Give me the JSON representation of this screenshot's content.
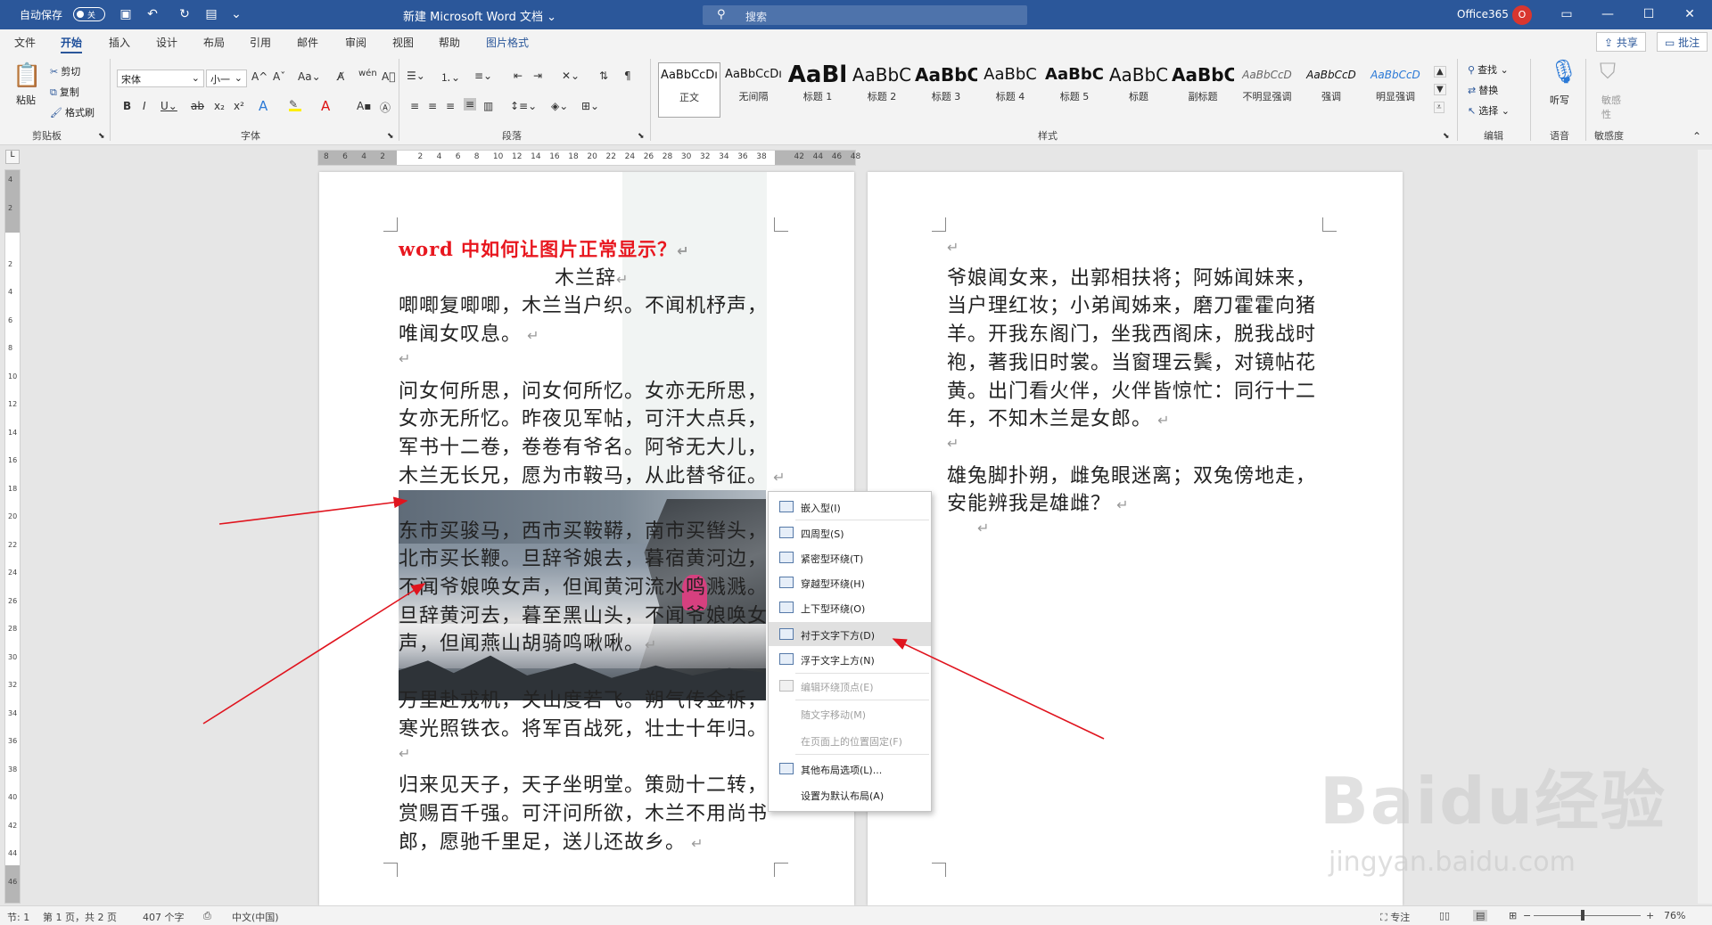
{
  "titlebar": {
    "autosave_label": "自动保存",
    "autosave_state": "关",
    "doc_title": "新建 Microsoft Word 文档",
    "search_placeholder": "搜索",
    "account": "Office365",
    "avatar_letter": "O"
  },
  "tabs": [
    "文件",
    "开始",
    "插入",
    "设计",
    "布局",
    "引用",
    "邮件",
    "审阅",
    "视图",
    "帮助",
    "图片格式"
  ],
  "active_tab": "开始",
  "share_label": "共享",
  "comment_label": "批注",
  "ribbon": {
    "clipboard": {
      "paste": "粘贴",
      "cut": "剪切",
      "copy": "复制",
      "format_painter": "格式刷",
      "group": "剪贴板"
    },
    "font": {
      "font_name": "宋体",
      "font_size": "小一",
      "group": "字体"
    },
    "paragraph": {
      "group": "段落"
    },
    "styles": {
      "group": "样式",
      "items": [
        {
          "sample": "AaBbCcDı",
          "name": "正文"
        },
        {
          "sample": "AaBbCcDı",
          "name": "无间隔"
        },
        {
          "sample": "AaBl",
          "name": "标题 1"
        },
        {
          "sample": "AaBbC",
          "name": "标题 2"
        },
        {
          "sample": "AaBbC",
          "name": "标题 3"
        },
        {
          "sample": "AaBbC",
          "name": "标题 4"
        },
        {
          "sample": "AaBbC",
          "name": "标题 5"
        },
        {
          "sample": "AaBbC",
          "name": "标题"
        },
        {
          "sample": "AaBbC",
          "name": "副标题"
        },
        {
          "sample": "AaBbCcD",
          "name": "不明显强调"
        },
        {
          "sample": "AaBbCcD",
          "name": "强调"
        },
        {
          "sample": "AaBbCcD",
          "name": "明显强调"
        }
      ]
    },
    "editing": {
      "find": "查找",
      "replace": "替换",
      "select": "选择",
      "group": "编辑"
    },
    "voice": {
      "dictate": "听写",
      "group": "语音"
    },
    "sensitivity": {
      "label": "敏感性",
      "group": "敏感度"
    }
  },
  "ruler_h_labels": [
    "8",
    "6",
    "4",
    "2",
    "",
    "2",
    "4",
    "6",
    "8",
    "10",
    "12",
    "14",
    "16",
    "18",
    "20",
    "22",
    "24",
    "26",
    "28",
    "30",
    "32",
    "34",
    "36",
    "38",
    "",
    "42",
    "44",
    "46",
    "48"
  ],
  "ruler_v_labels": [
    "4",
    "2",
    "",
    "2",
    "4",
    "6",
    "8",
    "10",
    "12",
    "14",
    "16",
    "18",
    "20",
    "22",
    "24",
    "26",
    "28",
    "30",
    "32",
    "34",
    "36",
    "38",
    "40",
    "42",
    "44",
    "46"
  ],
  "page1": {
    "title": "word 中如何让图片正常显示？",
    "subtitle": "木兰辞",
    "lines_above": [
      "唧唧复唧唧，木兰当户织。不闻机杼声，",
      "唯闻女叹息。",
      "",
      "问女何所思，问女何所忆。女亦无所思，",
      "女亦无所忆。昨夜见军帖，可汗大点兵，",
      "军书十二卷，卷卷有爷名。阿爷无大儿，",
      "木兰无长兄，愿为市鞍马，从此替爷征。"
    ],
    "lines_on_image": [
      "东市买骏马，西市买鞍鞯，南市买辔头，",
      "北市买长鞭。旦辞爷娘去，暮宿黄河边，",
      "不闻爷娘唤女声，但闻黄河流水鸣溅溅。",
      "旦辞黄河去，暮至黑山头，不闻爷娘唤女",
      "声，但闻燕山胡骑鸣啾啾。"
    ],
    "lines_below": [
      "万里赴戎机，关山度若飞。朔气传金柝，",
      "寒光照铁衣。将军百战死，壮士十年归。",
      "",
      "归来见天子，天子坐明堂。策勋十二转，",
      "赏赐百千强。可汗问所欲，木兰不用尚书",
      "郎，愿驰千里足，送儿还故乡。"
    ]
  },
  "page2": {
    "lines": [
      "",
      "爷娘闻女来，出郭相扶将；阿姊闻妹来，",
      "当户理红妆；小弟闻姊来，磨刀霍霍向猪",
      "羊。开我东阁门，坐我西阁床，脱我战时",
      "袍，著我旧时裳。当窗理云鬓，对镜帖花",
      "黄。出门看火伴，火伴皆惊忙：同行十二",
      "年，不知木兰是女郎。",
      "",
      "雄兔脚扑朔，雌兔眼迷离；双兔傍地走，",
      "安能辨我是雄雌？",
      ""
    ]
  },
  "context_menu": {
    "items": [
      {
        "label": "嵌入型(I)",
        "icon": "inline-wrap-icon",
        "disabled": false,
        "highlight": false
      },
      {
        "label": "四周型(S)",
        "icon": "square-wrap-icon",
        "disabled": false,
        "highlight": false
      },
      {
        "label": "紧密型环绕(T)",
        "icon": "tight-wrap-icon",
        "disabled": false,
        "highlight": false
      },
      {
        "label": "穿越型环绕(H)",
        "icon": "through-wrap-icon",
        "disabled": false,
        "highlight": false
      },
      {
        "label": "上下型环绕(O)",
        "icon": "top-bottom-wrap-icon",
        "disabled": false,
        "highlight": false
      },
      {
        "label": "衬于文字下方(D)",
        "icon": "behind-text-icon",
        "disabled": false,
        "highlight": true
      },
      {
        "label": "浮于文字上方(N)",
        "icon": "in-front-text-icon",
        "disabled": false,
        "highlight": false
      },
      {
        "label": "编辑环绕顶点(E)",
        "icon": "edit-wrap-points-icon",
        "disabled": true,
        "highlight": false
      },
      {
        "label": "随文字移动(M)",
        "icon": "",
        "disabled": true,
        "highlight": false
      },
      {
        "label": "在页面上的位置固定(F)",
        "icon": "",
        "disabled": true,
        "highlight": false
      },
      {
        "label": "其他布局选项(L)...",
        "icon": "layout-options-icon",
        "disabled": false,
        "highlight": false
      },
      {
        "label": "设置为默认布局(A)",
        "icon": "",
        "disabled": false,
        "highlight": false
      }
    ]
  },
  "statusbar": {
    "section": "节: 1",
    "page": "第 1 页，共 2 页",
    "words": "407 个字",
    "language": "中文(中国)",
    "focus": "专注",
    "zoom": "76%"
  },
  "watermark": {
    "brand": "Baidu经验",
    "url": "jingyan.baidu.com"
  },
  "colors": {
    "title_bar": "#2b579a",
    "title_red": "#e8171f",
    "arrow": "#e0141e"
  }
}
